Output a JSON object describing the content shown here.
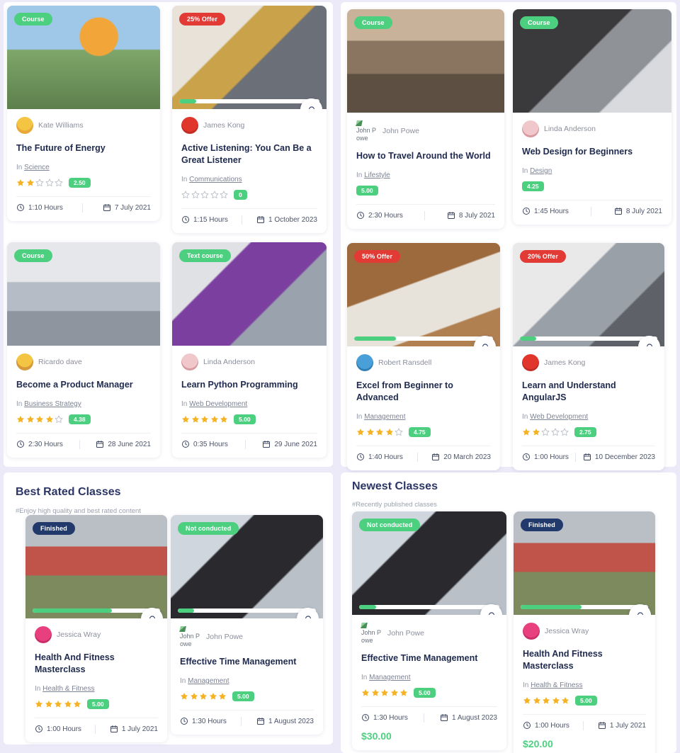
{
  "theme": {
    "page_bg": "#eceaf8",
    "accent_green": "#4cd080",
    "accent_red": "#e23a35",
    "accent_navy": "#213a6b",
    "title_color": "#1f2a4e",
    "star_color": "#f5b324"
  },
  "labels": {
    "in_prefix": "In",
    "tag_course": "Course",
    "tag_text_course": "Text course",
    "tag_finished": "Finished",
    "tag_not_conducted": "Not conducted"
  },
  "panels": {
    "left_top": {
      "cards": [
        {
          "tag": "Course",
          "tag_style": "green",
          "author": "Kate Williams",
          "author_broken": false,
          "title": "The Future of Energy",
          "category": "Science",
          "stars_filled": 2,
          "rating": "2.50",
          "show_stars": true,
          "hours": "1:10 Hours",
          "date": "7 July 2021",
          "progress": null,
          "bell": false,
          "price": null
        },
        {
          "tag": "25% Offer",
          "tag_style": "red",
          "author": "James Kong",
          "author_broken": false,
          "title": "Active Listening: You Can Be a Great Listener",
          "category": "Communications",
          "stars_filled": 0,
          "rating": "0",
          "show_stars": true,
          "hours": "1:15 Hours",
          "date": "1 October 2023",
          "progress": 12,
          "bell": true,
          "price": null
        },
        {
          "tag": "Course",
          "tag_style": "green",
          "author": "Ricardo dave",
          "author_broken": false,
          "title": "Become a Product Manager",
          "category": "Business Strategy",
          "stars_filled": 4,
          "rating": "4.38",
          "show_stars": true,
          "hours": "2:30 Hours",
          "date": "28 June 2021",
          "progress": null,
          "bell": false,
          "price": null
        },
        {
          "tag": "Text course",
          "tag_style": "green",
          "author": "Linda Anderson",
          "author_broken": false,
          "title": "Learn Python Programming",
          "category": "Web Development",
          "stars_filled": 5,
          "rating": "5.00",
          "show_stars": true,
          "hours": "0:35 Hours",
          "date": "29 June 2021",
          "progress": null,
          "bell": false,
          "price": null
        }
      ]
    },
    "right_top": {
      "cards": [
        {
          "tag": "Course",
          "tag_style": "green",
          "author": "John Powe",
          "author_broken": true,
          "title": "How to Travel Around the World",
          "category": "Lifestyle",
          "stars_filled": 0,
          "rating": "5.00",
          "show_stars": false,
          "hours": "2:30 Hours",
          "date": "8 July 2021",
          "progress": null,
          "bell": false,
          "price": null
        },
        {
          "tag": "Course",
          "tag_style": "green",
          "author": "Linda Anderson",
          "author_broken": false,
          "title": "Web Design for Beginners",
          "category": "Design",
          "stars_filled": 0,
          "rating": "4.25",
          "show_stars": false,
          "hours": "1:45 Hours",
          "date": "8 July 2021",
          "progress": null,
          "bell": false,
          "price": null
        },
        {
          "tag": "50% Offer",
          "tag_style": "red",
          "author": "Robert Ransdell",
          "author_broken": false,
          "title": "Excel from Beginner to Advanced",
          "category": "Management",
          "stars_filled": 4,
          "rating": "4.75",
          "show_stars": true,
          "hours": "1:40 Hours",
          "date": "20 March 2023",
          "progress": 30,
          "bell": true,
          "price": null
        },
        {
          "tag": "20% Offer",
          "tag_style": "red",
          "author": "James Kong",
          "author_broken": false,
          "title": "Learn and Understand AngularJS",
          "category": "Web Development",
          "stars_filled": 2,
          "rating": "2.75",
          "show_stars": true,
          "hours": "1:00 Hours",
          "date": "10 December 2023",
          "progress": 12,
          "bell": true,
          "price": null
        }
      ]
    },
    "best_rated": {
      "heading": "Best Rated Classes",
      "subheading": "#Enjoy high quality and best rated content",
      "cards": [
        {
          "tag": "Finished",
          "tag_style": "navy",
          "author": "Jessica Wray",
          "author_broken": false,
          "title": "Health And Fitness Masterclass",
          "category": "Health & Fitness",
          "stars_filled": 5,
          "rating": "5.00",
          "show_stars": true,
          "hours": "1:00 Hours",
          "date": "1 July 2021",
          "progress": 62,
          "bell": true,
          "price": null
        },
        {
          "tag": "Not conducted",
          "tag_style": "green",
          "author": "John Powe",
          "author_broken": true,
          "title": "Effective Time Management",
          "category": "Management",
          "stars_filled": 5,
          "rating": "5.00",
          "show_stars": true,
          "hours": "1:30 Hours",
          "date": "1 August 2023",
          "progress": 12,
          "bell": true,
          "price": null
        }
      ]
    },
    "newest": {
      "heading": "Newest Classes",
      "subheading": "#Recently published classes",
      "cards": [
        {
          "tag": "Not conducted",
          "tag_style": "green",
          "author": "John Powe",
          "author_broken": true,
          "title": "Effective Time Management",
          "category": "Management",
          "stars_filled": 5,
          "rating": "5.00",
          "show_stars": true,
          "hours": "1:30 Hours",
          "date": "1 August 2023",
          "progress": 12,
          "bell": true,
          "price": "$30.00"
        },
        {
          "tag": "Finished",
          "tag_style": "navy",
          "author": "Jessica Wray",
          "author_broken": false,
          "title": "Health And Fitness Masterclass",
          "category": "Health & Fitness",
          "stars_filled": 5,
          "rating": "5.00",
          "show_stars": true,
          "hours": "1:00 Hours",
          "date": "1 July 2021",
          "progress": 48,
          "bell": true,
          "price": "$20.00"
        }
      ]
    }
  }
}
